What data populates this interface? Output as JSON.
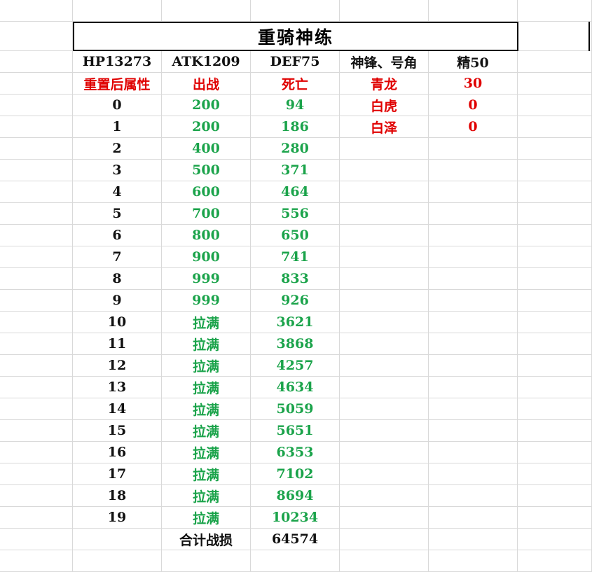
{
  "title": "重骑神练",
  "header_row": [
    "HP13273",
    "ATK1209",
    "DEF75",
    "神锋、号角",
    "精50"
  ],
  "subheader_row": [
    "重置后属性",
    "出战",
    "死亡",
    "青龙",
    "30"
  ],
  "side_table": [
    {
      "name": "白虎",
      "value": "0"
    },
    {
      "name": "白泽",
      "value": "0"
    }
  ],
  "rows": [
    {
      "level": "0",
      "deploy": "200",
      "death": "94"
    },
    {
      "level": "1",
      "deploy": "200",
      "death": "186"
    },
    {
      "level": "2",
      "deploy": "400",
      "death": "280"
    },
    {
      "level": "3",
      "deploy": "500",
      "death": "371"
    },
    {
      "level": "4",
      "deploy": "600",
      "death": "464"
    },
    {
      "level": "5",
      "deploy": "700",
      "death": "556"
    },
    {
      "level": "6",
      "deploy": "800",
      "death": "650"
    },
    {
      "level": "7",
      "deploy": "900",
      "death": "741"
    },
    {
      "level": "8",
      "deploy": "999",
      "death": "833"
    },
    {
      "level": "9",
      "deploy": "999",
      "death": "926"
    },
    {
      "level": "10",
      "deploy": "拉满",
      "death": "3621"
    },
    {
      "level": "11",
      "deploy": "拉满",
      "death": "3868"
    },
    {
      "level": "12",
      "deploy": "拉满",
      "death": "4257"
    },
    {
      "level": "13",
      "deploy": "拉满",
      "death": "4634"
    },
    {
      "level": "14",
      "deploy": "拉满",
      "death": "5059"
    },
    {
      "level": "15",
      "deploy": "拉满",
      "death": "5651"
    },
    {
      "level": "16",
      "deploy": "拉满",
      "death": "6353"
    },
    {
      "level": "17",
      "deploy": "拉满",
      "death": "7102"
    },
    {
      "level": "18",
      "deploy": "拉满",
      "death": "8694"
    },
    {
      "level": "19",
      "deploy": "拉满",
      "death": "10234"
    }
  ],
  "total_label": "合计战损",
  "total_value": "64574",
  "colors": {
    "red": "#e00000",
    "green": "#1aa34a",
    "grid": "#d9d9d9"
  }
}
